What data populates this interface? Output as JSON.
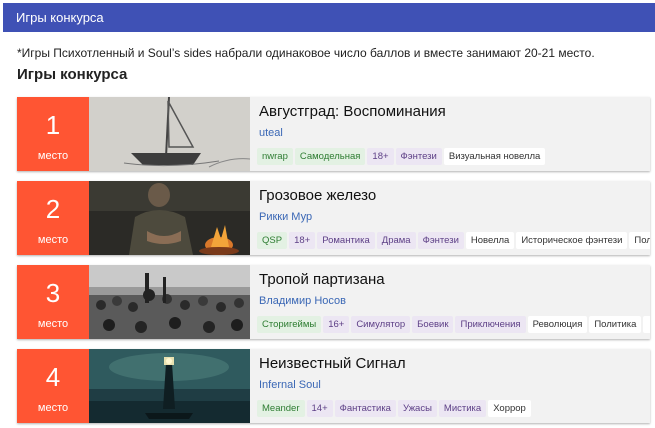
{
  "header": {
    "title": "Игры конкурса"
  },
  "note": "*Игры Психотленный и Soul’s sides набрали одинаковое число баллов и вместе занимают 20-21 место.",
  "section_title": "Игры конкурса",
  "rank_label": "место",
  "games": [
    {
      "rank": "1",
      "title": "Августград: Воспоминания",
      "author": "uteal",
      "image": "sailboat-sketch-image",
      "tags": [
        {
          "text": "nwrap",
          "kind": "platform"
        },
        {
          "text": "Самодельная",
          "kind": "platform"
        },
        {
          "text": "18+",
          "kind": "genre"
        },
        {
          "text": "Фэнтези",
          "kind": "genre"
        },
        {
          "text": "Визуальная новелла",
          "kind": "custom"
        }
      ]
    },
    {
      "rank": "2",
      "title": "Грозовое железо",
      "author": "Рикки Мур",
      "image": "campfire-man-image",
      "tags": [
        {
          "text": "QSP",
          "kind": "platform"
        },
        {
          "text": "18+",
          "kind": "genre"
        },
        {
          "text": "Романтика",
          "kind": "genre"
        },
        {
          "text": "Драма",
          "kind": "genre"
        },
        {
          "text": "Фэнтези",
          "kind": "genre"
        },
        {
          "text": "Новелла",
          "kind": "custom"
        },
        {
          "text": "Историческое фэнтези",
          "kind": "custom"
        },
        {
          "text": "Пол",
          "kind": "custom"
        }
      ]
    },
    {
      "rank": "3",
      "title": "Тропой партизана",
      "author": "Владимир Носов",
      "image": "crowd-photo-image",
      "tags": [
        {
          "text": "Сторигеймы",
          "kind": "platform"
        },
        {
          "text": "16+",
          "kind": "genre"
        },
        {
          "text": "Симулятор",
          "kind": "genre"
        },
        {
          "text": "Боевик",
          "kind": "genre"
        },
        {
          "text": "Приключения",
          "kind": "genre"
        },
        {
          "text": "Революция",
          "kind": "custom"
        },
        {
          "text": "Политика",
          "kind": "custom"
        },
        {
          "text": "",
          "kind": "custom"
        }
      ]
    },
    {
      "rank": "4",
      "title": "Неизвестный Сигнал",
      "author": "Infernal Soul",
      "image": "lighthouse-image",
      "tags": [
        {
          "text": "Meander",
          "kind": "platform"
        },
        {
          "text": "14+",
          "kind": "genre"
        },
        {
          "text": "Фантастика",
          "kind": "genre"
        },
        {
          "text": "Ужасы",
          "kind": "genre"
        },
        {
          "text": "Мистика",
          "kind": "genre"
        },
        {
          "text": "Хоррор",
          "kind": "custom"
        }
      ]
    }
  ],
  "colors": {
    "topbar": "#3f51b5",
    "rank": "#ff5533",
    "author": "#3a67b5"
  }
}
